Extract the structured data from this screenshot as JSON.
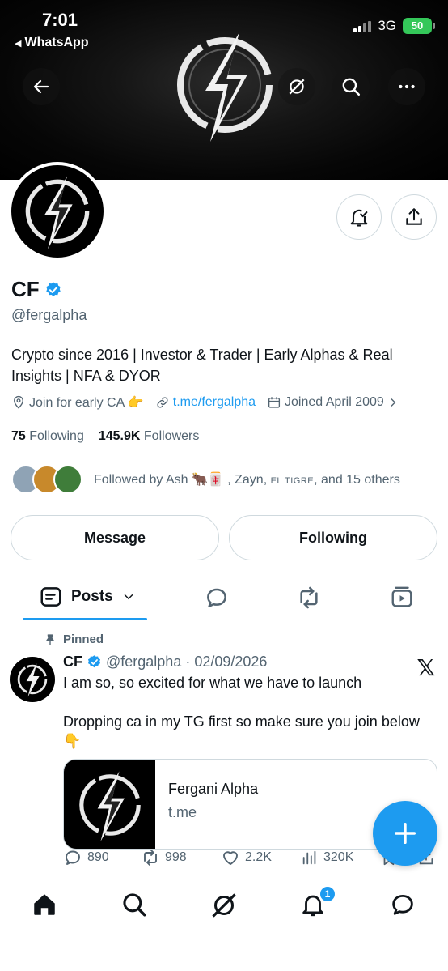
{
  "status_bar": {
    "time": "7:01",
    "back_app": "WhatsApp",
    "network": "3G",
    "battery": "50"
  },
  "profile": {
    "name": "CF",
    "handle": "@fergalpha",
    "bio": "Crypto since 2016 | Investor & Trader | Early Alphas & Real Insights | NFA & DYOR",
    "location": "Join for early CA 👉",
    "link": "t.me/fergalpha",
    "joined": "Joined April 2009",
    "following_count": "75",
    "following_label": "Following",
    "followers_count": "145.9K",
    "followers_label": "Followers",
    "followed_by_prefix": "Followed by Ash 🐂🀄 , Zayn, ",
    "followed_by_tigre": "EL TIGRE",
    "followed_by_suffix": ", and 15 others",
    "message_label": "Message",
    "following_button_label": "Following"
  },
  "tabs": {
    "posts_label": "Posts"
  },
  "pinned_post": {
    "pinned_label": "Pinned",
    "author": "CF",
    "handle": "@fergalpha",
    "date": "02/09/2026",
    "text": "I am so, so excited for what we have to launch\n\nDropping ca in my TG first so make sure you join below 👇",
    "card_title": "Fergani Alpha",
    "card_domain": "t.me",
    "replies": "890",
    "reposts": "998",
    "likes": "2.2K",
    "views": "320K",
    "x_logo": "𝕏"
  },
  "bottom_nav": {
    "notifications_badge": "1"
  },
  "colors": {
    "accent": "#1d9bf0",
    "text": "#0f1419",
    "secondary": "#536471",
    "battery": "#34c759"
  }
}
